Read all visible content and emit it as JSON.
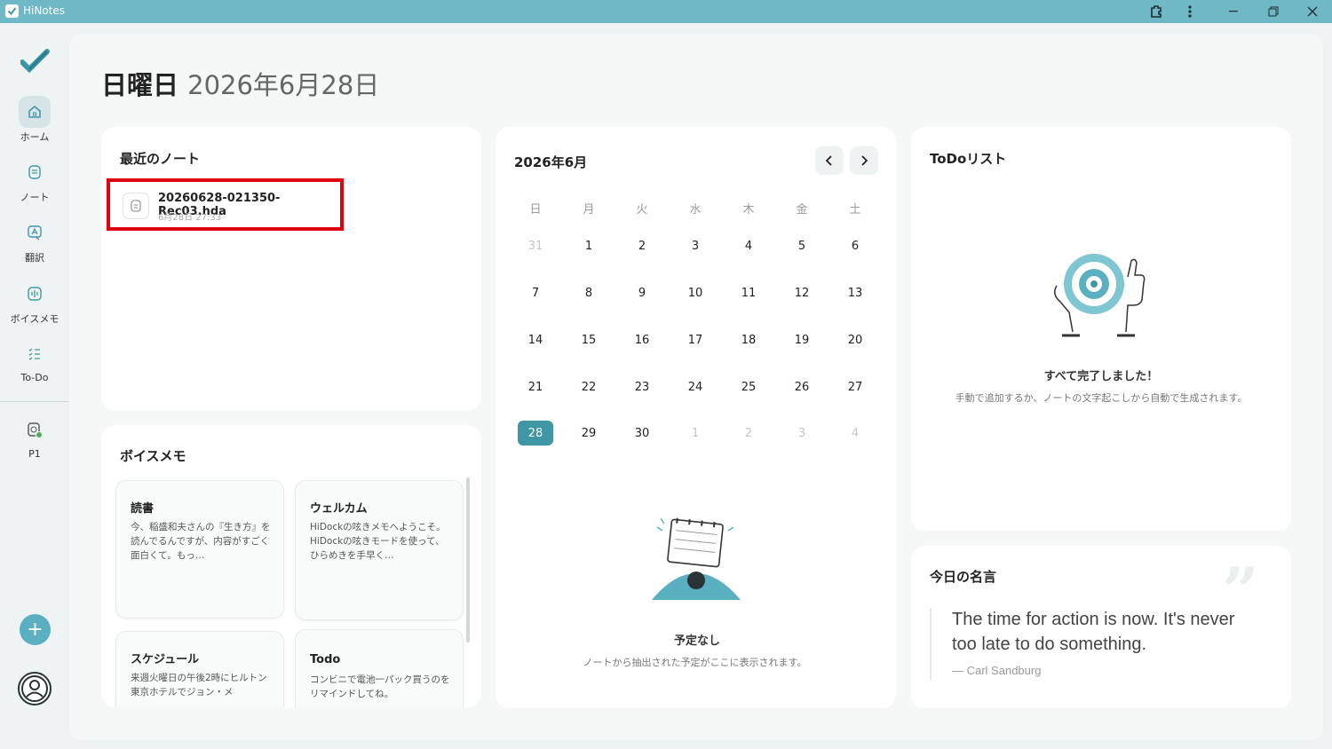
{
  "window": {
    "app_title": "HiNotes"
  },
  "sidebar": {
    "items": [
      {
        "label": "ホーム",
        "icon": "home-icon"
      },
      {
        "label": "ノート",
        "icon": "note-icon"
      },
      {
        "label": "翻訳",
        "icon": "translate-icon"
      },
      {
        "label": "ボイスメモ",
        "icon": "voice-memo-icon"
      },
      {
        "label": "To-Do",
        "icon": "todo-list-icon"
      },
      {
        "label": "P1",
        "icon": "device-icon"
      }
    ],
    "add_label": "+"
  },
  "header": {
    "weekday": "日曜日",
    "date": "2026年6月28日"
  },
  "recent_notes": {
    "title": "最近のノート",
    "items": [
      {
        "name": "20260628-021350-Rec03.hda",
        "time": "6月28日 27:33"
      }
    ]
  },
  "voice_memos": {
    "title": "ボイスメモ",
    "items": [
      {
        "title": "読書",
        "body": "今、稲盛和夫さんの『生き方』を読んでるんですが、内容がすごく面白くて。もっ…"
      },
      {
        "title": "ウェルカム",
        "body": "HiDockの呟きメモへようこそ。HiDockの呟きモードを使って、ひらめきを手早く…"
      },
      {
        "title": "スケジュール",
        "body": "来週火曜日の午後2時にヒルトン東京ホテルでジョン・メ"
      },
      {
        "title": "Todo",
        "body": "コンビニで電池一パック買うのをリマインドしてね。"
      }
    ]
  },
  "calendar": {
    "title": "2026年6月",
    "weekdays": [
      "日",
      "月",
      "火",
      "水",
      "木",
      "金",
      "土"
    ],
    "weeks": [
      [
        "31",
        "1",
        "2",
        "3",
        "4",
        "5",
        "6"
      ],
      [
        "7",
        "8",
        "9",
        "10",
        "11",
        "12",
        "13"
      ],
      [
        "14",
        "15",
        "16",
        "17",
        "18",
        "19",
        "20"
      ],
      [
        "21",
        "22",
        "23",
        "24",
        "25",
        "26",
        "27"
      ],
      [
        "28",
        "29",
        "30",
        "1",
        "2",
        "3",
        "4"
      ]
    ],
    "selected_day": "28",
    "empty_title": "予定なし",
    "empty_sub": "ノートから抽出された予定がここに表示されます。"
  },
  "todo": {
    "title": "ToDoリスト",
    "empty_title": "すべて完了しました！",
    "empty_sub": "手動で追加するか、ノートの文字起こしから自動で生成されます。"
  },
  "quote": {
    "title": "今日の名言",
    "text": "The time for action is now. It's never too late to do something.",
    "author": "— Carl Sandburg"
  },
  "colors": {
    "accent": "#3f97a6",
    "titlebar": "#6fb8c6",
    "highlight": "#e0000f"
  }
}
